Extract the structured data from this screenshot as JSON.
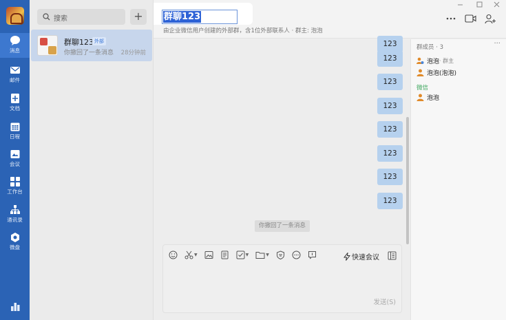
{
  "nav": {
    "items": [
      {
        "label": "消息",
        "icon": "chat-bubble-icon"
      },
      {
        "label": "邮件",
        "icon": "mail-icon"
      },
      {
        "label": "文档",
        "icon": "document-icon"
      },
      {
        "label": "日程",
        "icon": "calendar-icon"
      },
      {
        "label": "会议",
        "icon": "meeting-icon"
      },
      {
        "label": "工作台",
        "icon": "workbench-icon"
      },
      {
        "label": "通讯录",
        "icon": "contacts-icon"
      },
      {
        "label": "微盘",
        "icon": "drive-icon"
      }
    ]
  },
  "search": {
    "placeholder": "搜索",
    "add": "+"
  },
  "conversations": [
    {
      "name": "群聊123",
      "badge": "外部",
      "last_message": "你撤回了一条消息",
      "time": "28分钟前"
    }
  ],
  "header": {
    "title": "群聊123",
    "subtitle": "由企业微信用户创建的外部群，含1位外部联系人 · 群主: 泡泡"
  },
  "messages": [
    "123",
    "123",
    "123",
    "123",
    "123",
    "123",
    "123",
    "123"
  ],
  "system_message": "你撤回了一条消息",
  "members": {
    "header": "群成员 · 3",
    "more": "···",
    "owner": {
      "name": "泡泡",
      "tag": "· 群主"
    },
    "member2": "泡泡(泡泡)",
    "wechat_label": "微信",
    "member3": "泡泡"
  },
  "composer": {
    "quick_meeting": "快速会议",
    "send": "发送(S)"
  },
  "colors": {
    "nav_bg": "#2b63b5",
    "selection": "#2d62d6",
    "bubble": "#b6d1ee",
    "wechat_green": "#3aa55a"
  }
}
